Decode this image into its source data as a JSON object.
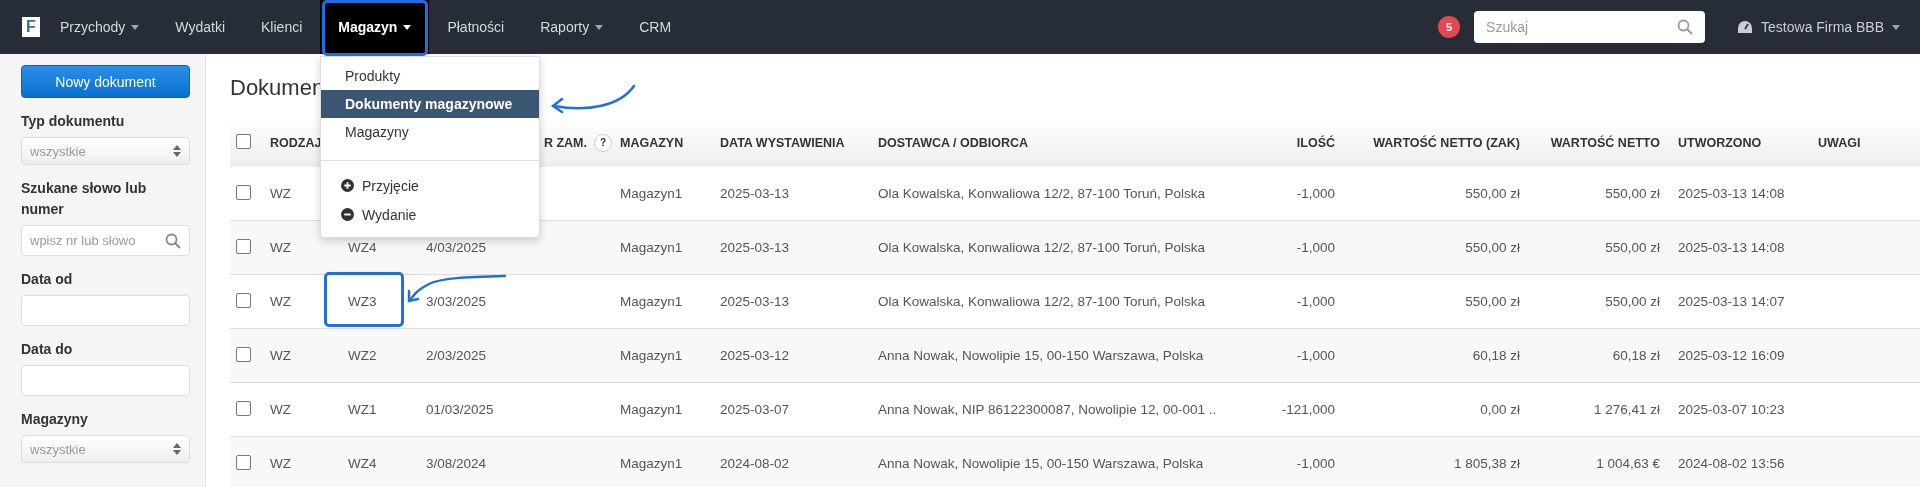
{
  "topbar": {
    "logo": "F",
    "nav": [
      {
        "label": "Przychody",
        "dropdown": true,
        "selected": false
      },
      {
        "label": "Wydatki",
        "dropdown": false,
        "selected": false
      },
      {
        "label": "Klienci",
        "dropdown": false,
        "selected": false
      },
      {
        "label": "Magazyn",
        "dropdown": true,
        "selected": true
      },
      {
        "label": "Płatności",
        "dropdown": false,
        "selected": false
      },
      {
        "label": "Raporty",
        "dropdown": true,
        "selected": false
      },
      {
        "label": "CRM",
        "dropdown": false,
        "selected": false
      }
    ],
    "notifications": "5",
    "search": {
      "placeholder": "Szukaj"
    },
    "account": "Testowa Firma BBB"
  },
  "menu": {
    "items": [
      {
        "label": "Produkty",
        "selected": false
      },
      {
        "label": "Dokumenty magazynowe",
        "selected": true
      },
      {
        "label": "Magazyny",
        "selected": false
      }
    ],
    "actions": [
      {
        "label": "Przyjęcie",
        "kind": "add"
      },
      {
        "label": "Wydanie",
        "kind": "remove"
      }
    ]
  },
  "sidebar": {
    "new_button": "Nowy dokument",
    "filters": [
      {
        "label": "Typ dokumentu",
        "kind": "select",
        "value": "wszystkie"
      },
      {
        "label": "Szukane słowo lub numer",
        "kind": "search",
        "placeholder": "wpisz nr lub słowo"
      },
      {
        "label": "Data od",
        "kind": "date"
      },
      {
        "label": "Data do",
        "kind": "date"
      },
      {
        "label": "Magazyny",
        "kind": "select",
        "value": "wszystkie"
      }
    ]
  },
  "title": "Dokumen",
  "table": {
    "select_all": {
      "checked": false
    },
    "columns": [
      {
        "label": "RODZAJ"
      },
      {
        "label": "R ZAM.",
        "help": "?"
      },
      {
        "label": "MAGAZYN"
      },
      {
        "label": "DATA WYSTAWIENIA"
      },
      {
        "label": "DOSTAWCA / ODBIORCA"
      },
      {
        "label": "ILOŚĆ"
      },
      {
        "label": "WARTOŚĆ NETTO (ZAK)"
      },
      {
        "label": "WARTOŚĆ NETTO"
      },
      {
        "label": "UTWORZONO"
      },
      {
        "label": "UWAGI"
      }
    ],
    "rows": [
      {
        "checked": false,
        "type": "WZ",
        "warehouse": "Magazyn1",
        "issue_date": "2025-03-13",
        "party": "Ola Kowalska, Konwaliowa 12/2, 87-100 Toruń, Polska",
        "quantity": "-1,000",
        "net_purchase": "550,00 zł",
        "net": "550,00 zł",
        "created": "2025-03-13 14:08"
      },
      {
        "checked": false,
        "type": "WZ",
        "number": "WZ4",
        "order": "4/03/2025",
        "warehouse": "Magazyn1",
        "issue_date": "2025-03-13",
        "party": "Ola Kowalska, Konwaliowa 12/2, 87-100 Toruń, Polska",
        "quantity": "-1,000",
        "net_purchase": "550,00 zł",
        "net": "550,00 zł",
        "created": "2025-03-13 14:08"
      },
      {
        "checked": false,
        "type": "WZ",
        "number": "WZ3",
        "order": "3/03/2025",
        "warehouse": "Magazyn1",
        "issue_date": "2025-03-13",
        "party": "Ola Kowalska, Konwaliowa 12/2, 87-100 Toruń, Polska",
        "quantity": "-1,000",
        "net_purchase": "550,00 zł",
        "net": "550,00 zł",
        "created": "2025-03-13 14:07"
      },
      {
        "checked": false,
        "type": "WZ",
        "number": "WZ2",
        "order": "2/03/2025",
        "warehouse": "Magazyn1",
        "issue_date": "2025-03-12",
        "party": "Anna Nowak, Nowolipie 15, 00-150 Warszawa, Polska",
        "quantity": "-1,000",
        "net_purchase": "60,18 zł",
        "net": "60,18 zł",
        "created": "2025-03-12 16:09"
      },
      {
        "checked": false,
        "type": "WZ",
        "number": "WZ1",
        "order": "01/03/2025",
        "warehouse": "Magazyn1",
        "issue_date": "2025-03-07",
        "party": "Anna Nowak, NIP 86122300087, Nowolipie 12, 00-001 ..",
        "quantity": "-121,000",
        "net_purchase": "0,00 zł",
        "net": "1 276,41 zł",
        "created": "2025-03-07 10:23"
      },
      {
        "checked": false,
        "type": "WZ",
        "number": "WZ4",
        "order": "3/08/2024",
        "warehouse": "Magazyn1",
        "issue_date": "2024-08-02",
        "party": "Anna Nowak, Nowolipie 15, 00-150 Warszawa, Polska",
        "quantity": "-1,000",
        "net_purchase": "1 805,38 zł",
        "net": "1 004,63 €",
        "created": "2024-08-02 13:56"
      }
    ]
  }
}
